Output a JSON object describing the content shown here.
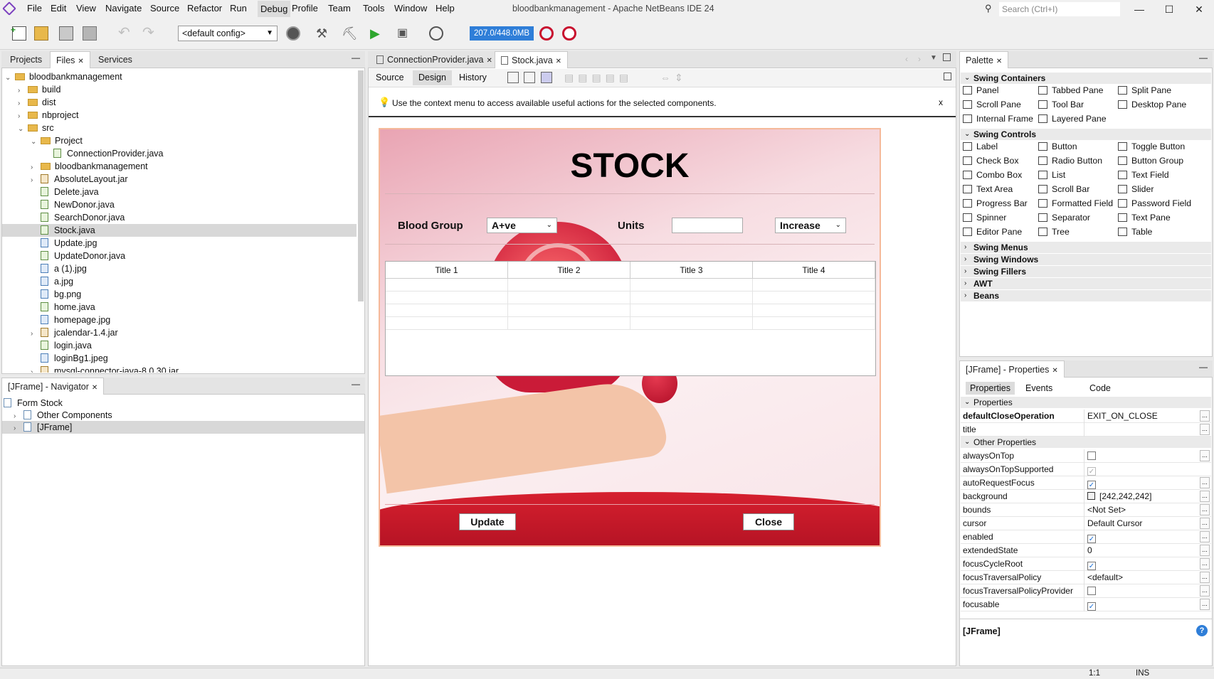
{
  "window": {
    "title": "bloodbankmanagement - Apache NetBeans IDE 24",
    "search_placeholder": "Search (Ctrl+I)",
    "menus": [
      "File",
      "Edit",
      "View",
      "Navigate",
      "Source",
      "Refactor",
      "Run",
      "Debug",
      "Profile",
      "Team",
      "Tools",
      "Window",
      "Help"
    ],
    "active_menu": "Debug"
  },
  "toolbar": {
    "config_select": "<default config>",
    "memory": "207.0/448.0MB"
  },
  "left_panel": {
    "tabs": [
      "Projects",
      "Files",
      "Services"
    ],
    "selected_tab": "Files",
    "tree": [
      {
        "label": "bloodbankmanagement",
        "depth": 0,
        "type": "folder",
        "expanded": true
      },
      {
        "label": "build",
        "depth": 1,
        "type": "folder",
        "expanded": false
      },
      {
        "label": "dist",
        "depth": 1,
        "type": "folder",
        "expanded": false
      },
      {
        "label": "nbproject",
        "depth": 1,
        "type": "folder",
        "expanded": false
      },
      {
        "label": "src",
        "depth": 1,
        "type": "folder",
        "expanded": true
      },
      {
        "label": "Project",
        "depth": 2,
        "type": "folder",
        "expanded": true
      },
      {
        "label": "ConnectionProvider.java",
        "depth": 3,
        "type": "java"
      },
      {
        "label": "bloodbankmanagement",
        "depth": 2,
        "type": "folder",
        "expanded": false
      },
      {
        "label": "AbsoluteLayout.jar",
        "depth": 2,
        "type": "jar",
        "expandable": true
      },
      {
        "label": "Delete.java",
        "depth": 2,
        "type": "java"
      },
      {
        "label": "NewDonor.java",
        "depth": 2,
        "type": "java"
      },
      {
        "label": "SearchDonor.java",
        "depth": 2,
        "type": "java"
      },
      {
        "label": "Stock.java",
        "depth": 2,
        "type": "java",
        "selected": true
      },
      {
        "label": "Update.jpg",
        "depth": 2,
        "type": "img"
      },
      {
        "label": "UpdateDonor.java",
        "depth": 2,
        "type": "java"
      },
      {
        "label": "a (1).jpg",
        "depth": 2,
        "type": "img"
      },
      {
        "label": "a.jpg",
        "depth": 2,
        "type": "img"
      },
      {
        "label": "bg.png",
        "depth": 2,
        "type": "img"
      },
      {
        "label": "home.java",
        "depth": 2,
        "type": "java"
      },
      {
        "label": "homepage.jpg",
        "depth": 2,
        "type": "img"
      },
      {
        "label": "jcalendar-1.4.jar",
        "depth": 2,
        "type": "jar",
        "expandable": true
      },
      {
        "label": "login.java",
        "depth": 2,
        "type": "java"
      },
      {
        "label": "loginBg1.jpeg",
        "depth": 2,
        "type": "img"
      },
      {
        "label": "mysql-connector-java-8.0.30.jar",
        "depth": 2,
        "type": "jar",
        "expandable": true
      }
    ]
  },
  "navigator": {
    "title": "[JFrame] - Navigator",
    "items": [
      {
        "label": "Form Stock",
        "depth": 0
      },
      {
        "label": "Other Components",
        "depth": 1
      },
      {
        "label": "[JFrame]",
        "depth": 1,
        "selected": true
      }
    ]
  },
  "editor": {
    "tabs": [
      {
        "label": "ConnectionProvider.java",
        "selected": false
      },
      {
        "label": "Stock.java",
        "selected": true
      }
    ],
    "subtabs": [
      "Source",
      "Design",
      "History"
    ],
    "selected_subtab": "Design",
    "hint": "Use the context menu to access available useful actions for the selected components.",
    "hint_close": "x"
  },
  "form": {
    "title": "STOCK",
    "blood_group_label": "Blood Group",
    "blood_group_value": "A+ve",
    "units_label": "Units",
    "units_value": "",
    "action_value": "Increase",
    "table_headers": [
      "Title 1",
      "Title 2",
      "Title 3",
      "Title 4"
    ],
    "table_rows": 4,
    "update_button": "Update",
    "close_button": "Close",
    "colors": {
      "accent_red": "#c8102e",
      "bg_pink": "#f3c9cf"
    }
  },
  "palette": {
    "title": "Palette",
    "categories": [
      {
        "name": "Swing Containers",
        "items": [
          "Panel",
          "Tabbed Pane",
          "Split Pane",
          "Scroll Pane",
          "Tool Bar",
          "Desktop Pane",
          "Internal Frame",
          "Layered Pane"
        ]
      },
      {
        "name": "Swing Controls",
        "items": [
          "Label",
          "Button",
          "Toggle Button",
          "Check Box",
          "Radio Button",
          "Button Group",
          "Combo Box",
          "List",
          "Text Field",
          "Text Area",
          "Scroll Bar",
          "Slider",
          "Progress Bar",
          "Formatted Field",
          "Password Field",
          "Spinner",
          "Separator",
          "Text Pane",
          "Editor Pane",
          "Tree",
          "Table"
        ]
      },
      {
        "name": "Swing Menus",
        "items": []
      },
      {
        "name": "Swing Windows",
        "items": []
      },
      {
        "name": "Swing Fillers",
        "items": []
      },
      {
        "name": "AWT",
        "items": []
      },
      {
        "name": "Beans",
        "items": []
      }
    ]
  },
  "properties": {
    "title": "[JFrame] - Properties",
    "tabs": [
      "Properties",
      "Events",
      "Code"
    ],
    "selected_tab": "Properties",
    "section_properties": "Properties",
    "section_other": "Other Properties",
    "main_rows": [
      {
        "name": "defaultCloseOperation",
        "value": "EXIT_ON_CLOSE",
        "kind": "select",
        "bold": true
      },
      {
        "name": "title",
        "value": "",
        "kind": "text"
      }
    ],
    "other_rows": [
      {
        "name": "alwaysOnTop",
        "value": "",
        "kind": "check",
        "checked": false
      },
      {
        "name": "alwaysOnTopSupported",
        "value": "",
        "kind": "check",
        "checked": true,
        "disabled": true
      },
      {
        "name": "autoRequestFocus",
        "value": "",
        "kind": "check",
        "checked": true
      },
      {
        "name": "background",
        "value": "[242,242,242]",
        "kind": "color"
      },
      {
        "name": "bounds",
        "value": "<Not Set>",
        "kind": "text"
      },
      {
        "name": "cursor",
        "value": "Default Cursor",
        "kind": "select"
      },
      {
        "name": "enabled",
        "value": "",
        "kind": "check",
        "checked": true
      },
      {
        "name": "extendedState",
        "value": "0",
        "kind": "text"
      },
      {
        "name": "focusCycleRoot",
        "value": "",
        "kind": "check",
        "checked": true
      },
      {
        "name": "focusTraversalPolicy",
        "value": "<default>",
        "kind": "select"
      },
      {
        "name": "focusTraversalPolicyProvider",
        "value": "",
        "kind": "check",
        "checked": false
      },
      {
        "name": "focusable",
        "value": "",
        "kind": "check",
        "checked": true
      }
    ],
    "footer": "[JFrame]"
  },
  "status": {
    "position": "1:1",
    "mode": "INS"
  }
}
